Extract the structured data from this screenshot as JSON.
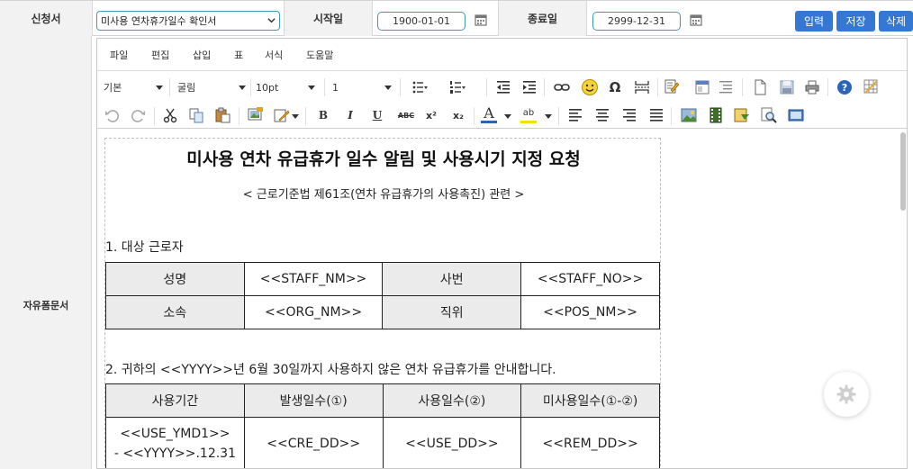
{
  "form": {
    "applicant_label": "신청서",
    "template_selected": "미사용 연차휴가일수 확인서",
    "start_label": "시작일",
    "start_date": "1900-01-01",
    "end_label": "종료일",
    "end_date": "2999-12-31",
    "buttons": {
      "input": "입력",
      "save": "저장",
      "delete": "삭제"
    },
    "free_doc_label": "자유폼문서"
  },
  "editor": {
    "menu": [
      "파일",
      "편집",
      "삽입",
      "표",
      "서식",
      "도움말"
    ],
    "toolbar": {
      "paragraph_style": "기본",
      "font_family": "굴림",
      "font_size": "10pt",
      "line_height": "1"
    },
    "icons_row1": [
      "bullet-list-icon",
      "numbered-list-icon",
      "outdent-icon",
      "indent-icon",
      "link-icon",
      "emoji-icon",
      "special-char-icon",
      "page-break-icon",
      "edit-document-icon",
      "template-icon",
      "align-block-icon",
      "new-document-icon",
      "save-disk-icon",
      "print-icon",
      "help-icon",
      "grid-icon"
    ],
    "icons_row2": [
      "undo-icon",
      "redo-icon",
      "cut-icon",
      "copy-icon",
      "paste-icon",
      "insert-image-icon",
      "edit-style-icon",
      "bold-icon",
      "italic-icon",
      "underline-icon",
      "strikethrough-icon",
      "superscript-icon",
      "subscript-icon",
      "font-color-icon",
      "highlight-icon",
      "align-left-icon",
      "align-center-icon",
      "align-right-icon",
      "align-justify-icon",
      "image-icon",
      "film-icon",
      "form-icon",
      "find-icon",
      "preview-icon"
    ],
    "glyphs": {
      "bold": "B",
      "italic": "I",
      "underline": "U",
      "strike": "ABC",
      "sup": "x²",
      "sub": "x₂",
      "fontcolor": "A",
      "highlight": "ab",
      "omega": "Ω",
      "help": "?"
    }
  },
  "document": {
    "title": "미사용 연차 유급휴가 일수 알림 및 사용시기 지정 요청",
    "subtitle": "< 근로기준법 제61조(연차 유급휴가의 사용촉진) 관련 >",
    "section1": "1. 대상 근로자",
    "table1": [
      [
        "성명",
        "<<STAFF_NM>>",
        "사번",
        "<<STAFF_NO>>"
      ],
      [
        "소속",
        "<<ORG_NM>>",
        "직위",
        "<<POS_NM>>"
      ]
    ],
    "section2": "2. 귀하의 <<YYYY>>년 6월 30일까지 사용하지 않은 연차 유급휴가를 안내합니다.",
    "table2_header": [
      "사용기간",
      "발생일수(①)",
      "사용일수(②)",
      "미사용일수(①-②)"
    ],
    "table2_row": {
      "period_line1": "<<USE_YMD1>>",
      "period_line2": "- <<YYYY>>.12.31",
      "cre": "<<CRE_DD>>",
      "use": "<<USE_DD>>",
      "rem": "<<REM_DD>>"
    }
  },
  "colors": {
    "accent": "#3478d4",
    "border_teal": "#3a9fb0",
    "label_bg": "#f2f2f2"
  }
}
